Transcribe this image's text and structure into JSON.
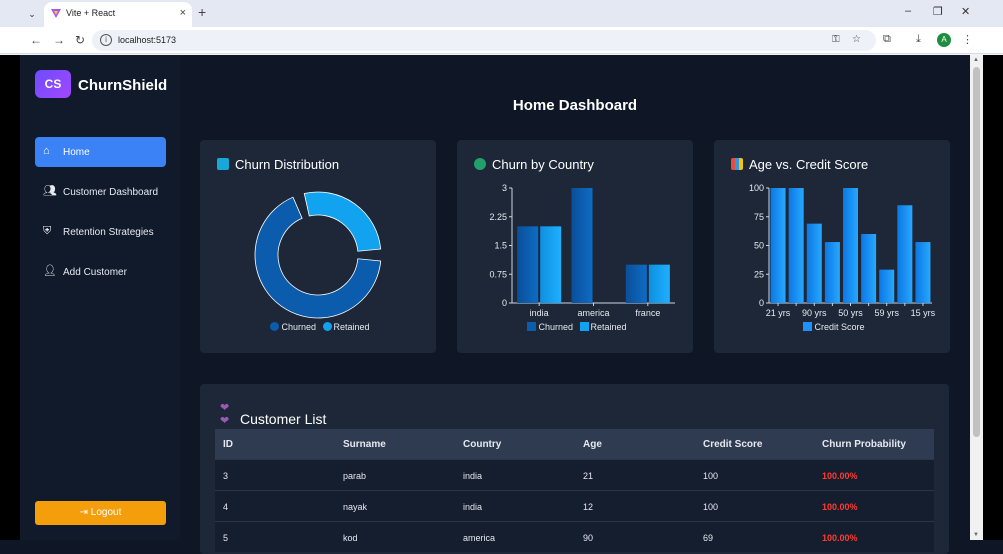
{
  "browser": {
    "tab_title": "Vite + React",
    "url": "localhost:5173",
    "avatar_letter": "A"
  },
  "app": {
    "brand_badge": "CS",
    "brand_name": "ChurnShield",
    "page_title": "Home Dashboard",
    "nav": [
      {
        "label": "Home",
        "icon": "home-icon",
        "active": true
      },
      {
        "label": "Customer Dashboard",
        "icon": "users-icon",
        "active": false
      },
      {
        "label": "Retention Strategies",
        "icon": "shield-icon",
        "active": false
      },
      {
        "label": "Add Customer",
        "icon": "user-plus-icon",
        "active": false
      }
    ],
    "logout_label": "Logout"
  },
  "charts": {
    "distribution": {
      "title": "Churn Distribution",
      "legend": [
        "Churned",
        "Retained"
      ]
    },
    "country": {
      "title": "Churn by Country",
      "legend": [
        "Churned",
        "Retained"
      ]
    },
    "age": {
      "title": "Age vs. Credit Score",
      "legend": [
        "Credit Score"
      ]
    }
  },
  "chart_data": [
    {
      "type": "pie",
      "title": "Churn Distribution",
      "categories": [
        "Churned",
        "Retained"
      ],
      "values": [
        70,
        30
      ],
      "colors": [
        "#0b5cad",
        "#12a3f0"
      ]
    },
    {
      "type": "bar",
      "title": "Churn by Country",
      "categories": [
        "india",
        "america",
        "france"
      ],
      "series": [
        {
          "name": "Churned",
          "values": [
            2,
            3,
            1
          ]
        },
        {
          "name": "Retained",
          "values": [
            2,
            0,
            1
          ]
        }
      ],
      "yticks": [
        "0",
        "0.75",
        "1.5",
        "2.25",
        "3"
      ],
      "ylim": [
        0,
        3
      ]
    },
    {
      "type": "bar",
      "title": "Age vs. Credit Score",
      "categories": [
        "21 yrs",
        "",
        "90 yrs",
        "",
        "50 yrs",
        "",
        "59 yrs",
        "",
        "15 yrs"
      ],
      "series": [
        {
          "name": "Credit Score",
          "values": [
            100,
            100,
            69,
            53,
            100,
            60,
            29,
            85,
            53
          ]
        }
      ],
      "yticks": [
        "0",
        "25",
        "50",
        "75",
        "100"
      ],
      "ylim": [
        0,
        100
      ]
    }
  ],
  "customers": {
    "title": "Customer List",
    "columns": [
      "ID",
      "Surname",
      "Country",
      "Age",
      "Credit Score",
      "Churn Probability"
    ],
    "rows": [
      {
        "id": "3",
        "surname": "parab",
        "country": "india",
        "age": "21",
        "credit": "100",
        "prob": "100.00%"
      },
      {
        "id": "4",
        "surname": "nayak",
        "country": "india",
        "age": "12",
        "credit": "100",
        "prob": "100.00%"
      },
      {
        "id": "5",
        "surname": "kod",
        "country": "america",
        "age": "90",
        "credit": "69",
        "prob": "100.00%"
      }
    ]
  }
}
